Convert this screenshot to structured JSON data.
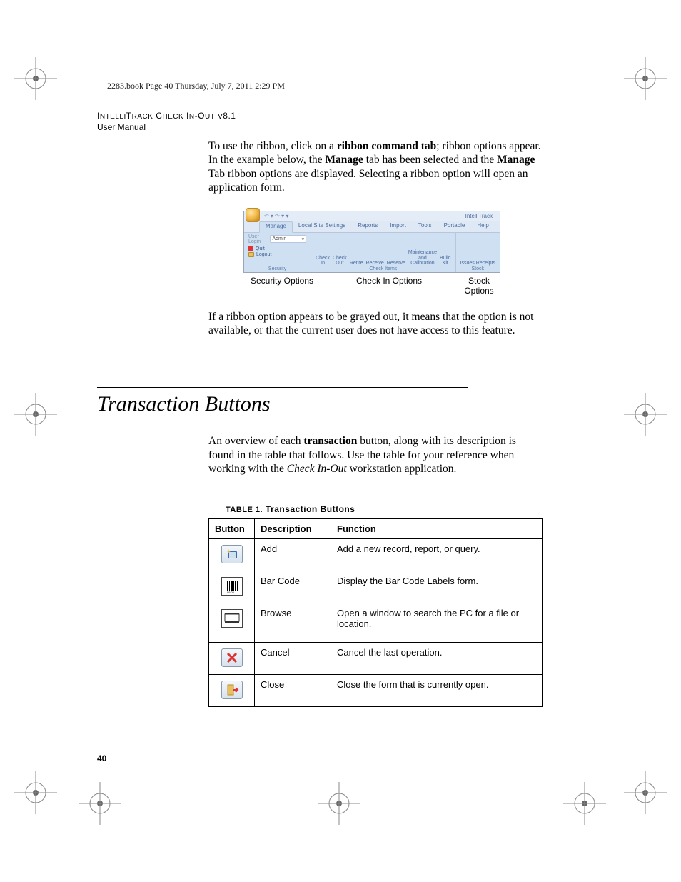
{
  "header_line": "2283.book  Page 40  Thursday, July 7, 2011  2:29 PM",
  "doc_title": "IntelliTrack Check In-Out v8.1",
  "doc_subtitle": "User Manual",
  "para1_a": "To use the ribbon, click on a ",
  "para1_b": "ribbon command tab",
  "para1_c": "; ribbon options appear. In the example below, the ",
  "para1_d": "Manage",
  "para1_e": " tab has been selected and the ",
  "para1_f": "Manage",
  "para1_g": " Tab ribbon options are displayed. Selecting a ribbon option will open an application form.",
  "ribbon": {
    "window_title": "IntelliTrack",
    "tabs": [
      "Manage",
      "Local Site Settings",
      "Reports",
      "Import",
      "Tools",
      "Portable",
      "Help"
    ],
    "user_login_label": "User Login",
    "user_login_value": "Admin",
    "quit": "Quit",
    "logout": "Logout",
    "groups": {
      "security": "Security",
      "check_items": "Check Items",
      "stock": "Stock"
    },
    "check_buttons": [
      "Check In",
      "Check Out",
      "Retire",
      "Receive",
      "Reserve",
      "Maintenance and Calibration",
      "Build Kit"
    ],
    "stock_buttons": [
      "Issues",
      "Receipts"
    ]
  },
  "caption_security": "Security Options",
  "caption_checkin": "Check In Options",
  "caption_stock": "Stock Options",
  "para2": "If a ribbon option appears to be grayed out, it means that the option is not available, or that the current user does not have access to this feature.",
  "section_heading": "Transaction Buttons",
  "intro_a": "An overview of each ",
  "intro_b": "transaction",
  "intro_c": " button, along with its description is found in the table that follows. Use the table for your reference when working with the ",
  "intro_d": "Check In-Out",
  "intro_e": " workstation application.",
  "table_caption_prefix": "TABLE 1.",
  "table_caption_title": " Transaction Buttons",
  "table": {
    "headers": [
      "Button",
      "Description",
      "Function"
    ],
    "rows": [
      {
        "desc": "Add",
        "func": "Add a new record, report, or query."
      },
      {
        "desc": "Bar Code",
        "func": "Display the Bar Code Labels form."
      },
      {
        "desc": "Browse",
        "func": "Open a window to search the PC for a file or location."
      },
      {
        "desc": "Cancel",
        "func": "Cancel the last operation."
      },
      {
        "desc": "Close",
        "func": "Close the form that is currently open."
      }
    ]
  },
  "page_number": "40"
}
